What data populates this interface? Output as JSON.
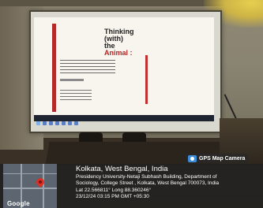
{
  "photo": {
    "description_hidden": "",
    "slide": {
      "title_line1": "Thinking",
      "title_line2": "(with)",
      "title_line3": "the",
      "title_line4": "Animal :"
    }
  },
  "stamp": {
    "badge_label": "GPS Map Camera",
    "badge_icon": "camera-icon",
    "location_title": "Kolkata, West Bengal, India",
    "address_line1": "Presidency University-Netaji Subhash Building, Department of",
    "address_line2": "Sociology, College Street , Kolkata, West Bengal 700073, India",
    "coordinates": "Lat 22.566811° Long 88.360246°",
    "datetime": "23/12/24 03:15 PM GMT +05:30",
    "map_label": "Google",
    "map_pin_color": "#d93025"
  }
}
